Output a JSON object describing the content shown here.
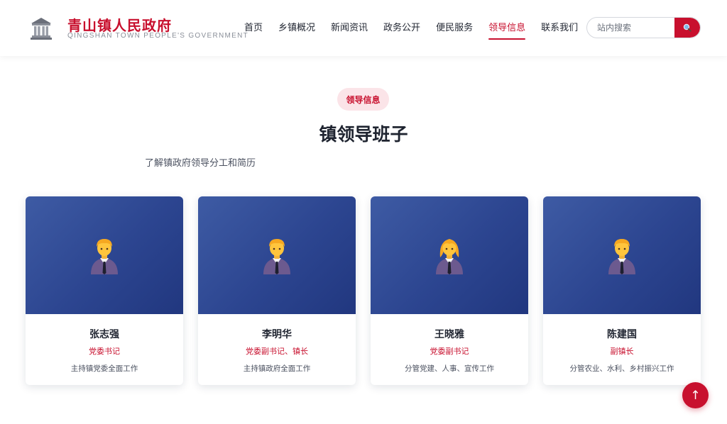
{
  "brand": {
    "title": "青山镇人民政府",
    "subtitle": "QINGSHAN TOWN PEOPLE'S GOVERNMENT",
    "logo_icon": "government-building-icon"
  },
  "nav": {
    "items": [
      {
        "label": "首页"
      },
      {
        "label": "乡镇概况"
      },
      {
        "label": "新闻资讯"
      },
      {
        "label": "政务公开"
      },
      {
        "label": "便民服务"
      },
      {
        "label": "领导信息"
      },
      {
        "label": "联系我们"
      }
    ],
    "active_label": "领导信息"
  },
  "search": {
    "placeholder": "站内搜索",
    "button_icon": "search-icon"
  },
  "section": {
    "badge": "领导信息",
    "title": "镇领导班子",
    "description": "了解镇政府领导分工和简历"
  },
  "leaders": [
    {
      "name": "张志强",
      "role": "党委书记",
      "duty": "主持镇党委全面工作",
      "avatar": "man-office-worker-emoji"
    },
    {
      "name": "李明华",
      "role": "党委副书记、镇长",
      "duty": "主持镇政府全面工作",
      "avatar": "man-office-worker-emoji"
    },
    {
      "name": "王晓雅",
      "role": "党委副书记",
      "duty": "分管党建、人事、宣传工作",
      "avatar": "woman-office-worker-emoji"
    },
    {
      "name": "陈建国",
      "role": "副镇长",
      "duty": "分管农业、水利、乡村振兴工作",
      "avatar": "man-office-worker-emoji"
    }
  ],
  "back_to_top": {
    "icon": "arrow-up-icon",
    "glyph": "↑"
  },
  "colors": {
    "accent": "#c8102e",
    "card_gradient_start": "#3e5ba4",
    "card_gradient_end": "#21377f",
    "badge_bg": "#fbe4e8"
  }
}
